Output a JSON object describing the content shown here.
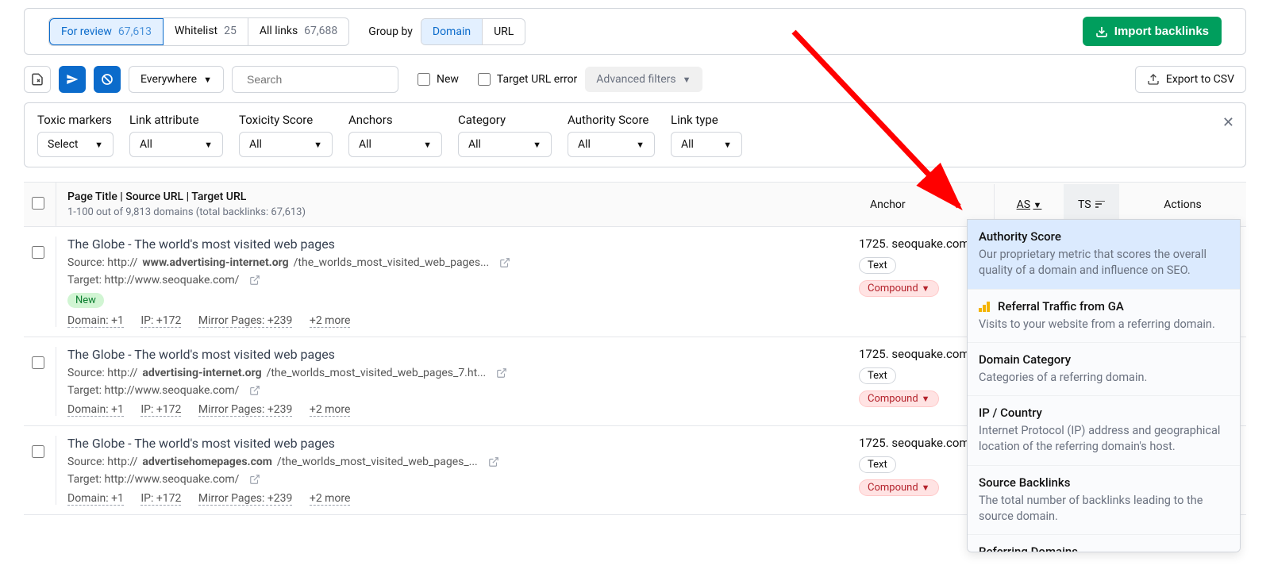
{
  "tabs": {
    "for_review": {
      "label": "For review",
      "count": "67,613"
    },
    "whitelist": {
      "label": "Whitelist",
      "count": "25"
    },
    "all_links": {
      "label": "All links",
      "count": "67,688"
    }
  },
  "group_by": {
    "label": "Group by",
    "domain": "Domain",
    "url": "URL"
  },
  "import_btn": "Import backlinks",
  "toolbar": {
    "everywhere": "Everywhere",
    "search_placeholder": "Search",
    "new": "New",
    "target_error": "Target URL error",
    "adv_filters": "Advanced filters",
    "export": "Export to CSV"
  },
  "filters": {
    "toxic_markers": {
      "label": "Toxic markers",
      "value": "Select"
    },
    "link_attribute": {
      "label": "Link attribute",
      "value": "All"
    },
    "toxicity_score": {
      "label": "Toxicity Score",
      "value": "All"
    },
    "anchors": {
      "label": "Anchors",
      "value": "All"
    },
    "category": {
      "label": "Category",
      "value": "All"
    },
    "authority_score": {
      "label": "Authority Score",
      "value": "All"
    },
    "link_type": {
      "label": "Link type",
      "value": "All"
    }
  },
  "table_head": {
    "main": "Page Title | Source URL | Target URL",
    "sub": "1-100 out of 9,813 domains (total backlinks: 67,613)",
    "anchor": "Anchor",
    "as": "AS",
    "ts": "TS",
    "actions": "Actions"
  },
  "rows": [
    {
      "title": "The Globe - The world's most visited web pages",
      "source_prefix": "Source: http://",
      "source_bold": "www.advertising-internet.org",
      "source_rest": "/the_worlds_most_visited_web_pages...",
      "target": "Target: http://www.seoquake.com/",
      "new_badge": "New",
      "stats": {
        "domain": "Domain: +1",
        "ip": "IP: +172",
        "mirror": "Mirror Pages: +239",
        "more": "+2 more"
      },
      "anchor_text": "1725. seoquake.com",
      "pill_text": "Text",
      "pill_compound": "Compound"
    },
    {
      "title": "The Globe - The world's most visited web pages",
      "source_prefix": "Source: http://",
      "source_bold": "advertising-internet.org",
      "source_rest": "/the_worlds_most_visited_web_pages_7.ht...",
      "target": "Target: http://www.seoquake.com/",
      "new_badge": "",
      "stats": {
        "domain": "Domain: +1",
        "ip": "IP: +172",
        "mirror": "Mirror Pages: +239",
        "more": "+2 more"
      },
      "anchor_text": "1725. seoquake.com",
      "pill_text": "Text",
      "pill_compound": "Compound"
    },
    {
      "title": "The Globe - The world's most visited web pages",
      "source_prefix": "Source: http://",
      "source_bold": "advertisehomepages.com",
      "source_rest": "/the_worlds_most_visited_web_pages_...",
      "target": "Target: http://www.seoquake.com/",
      "new_badge": "",
      "stats": {
        "domain": "Domain: +1",
        "ip": "IP: +172",
        "mirror": "Mirror Pages: +239",
        "more": "+2 more"
      },
      "anchor_text": "1725. seoquake.com",
      "pill_text": "Text",
      "pill_compound": "Compound"
    }
  ],
  "popup": [
    {
      "title": "Authority Score",
      "desc": "Our proprietary metric that scores the overall quality of a domain and influence on SEO.",
      "icon": ""
    },
    {
      "title": "Referral Traffic from GA",
      "desc": "Visits to your website from a referring domain.",
      "icon": "ga"
    },
    {
      "title": "Domain Category",
      "desc": "Categories of a referring domain.",
      "icon": ""
    },
    {
      "title": "IP / Country",
      "desc": "Internet Protocol (IP) address and geographical location of the referring domain's host.",
      "icon": ""
    },
    {
      "title": "Source Backlinks",
      "desc": "The total number of backlinks leading to the source domain.",
      "icon": ""
    },
    {
      "title": "Referring Domains",
      "desc": "",
      "icon": ""
    }
  ]
}
